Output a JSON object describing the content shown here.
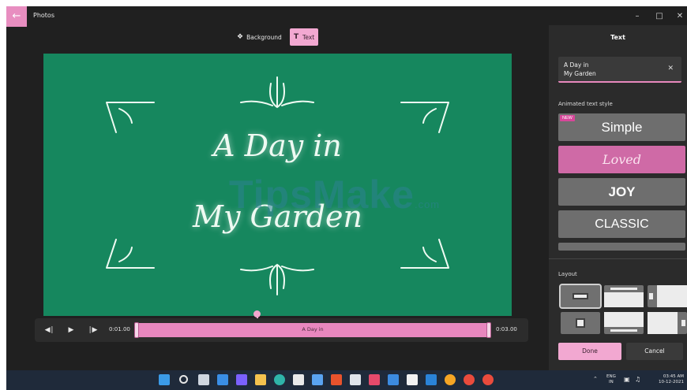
{
  "window": {
    "title": "Photos",
    "back_icon": "arrow-left-icon",
    "controls": [
      "minimize-icon",
      "maximize-icon",
      "close-icon"
    ]
  },
  "toolbar": {
    "background_label": "Background",
    "text_label": "Text"
  },
  "canvas": {
    "line1": "A Day in",
    "line2": "My Garden",
    "watermark": "TipsMake",
    "watermark_suffix": ".com",
    "background_color": "#16875e"
  },
  "timeline": {
    "start_time": "0:01.00",
    "end_time": "0:03.00",
    "clip_label": "A Day in"
  },
  "panel": {
    "title": "Text",
    "text_value_line1": "A Day in",
    "text_value_line2": "My Garden",
    "animated_style_label": "Animated text style",
    "styles": [
      {
        "label": "Simple",
        "badge": "NEW"
      },
      {
        "label": "Loved"
      },
      {
        "label": "JOY"
      },
      {
        "label": "CLASSIC"
      }
    ],
    "layout_label": "Layout",
    "done_label": "Done",
    "cancel_label": "Cancel",
    "accent_color": "#f2a8d1"
  },
  "taskbar": {
    "icons": [
      "windows-start-icon",
      "search-icon",
      "task-view-icon",
      "widgets-icon",
      "chat-icon",
      "file-explorer-icon",
      "edge-icon",
      "store-icon",
      "photos-icon",
      "office-icon",
      "app-icon",
      "app-icon",
      "app-icon",
      "app-icon",
      "app-icon",
      "chrome-icon",
      "google-icon",
      "google-icon"
    ],
    "language_line1": "ENG",
    "language_line2": "IN",
    "time": "03:45 AM",
    "date": "10-12-2021"
  }
}
